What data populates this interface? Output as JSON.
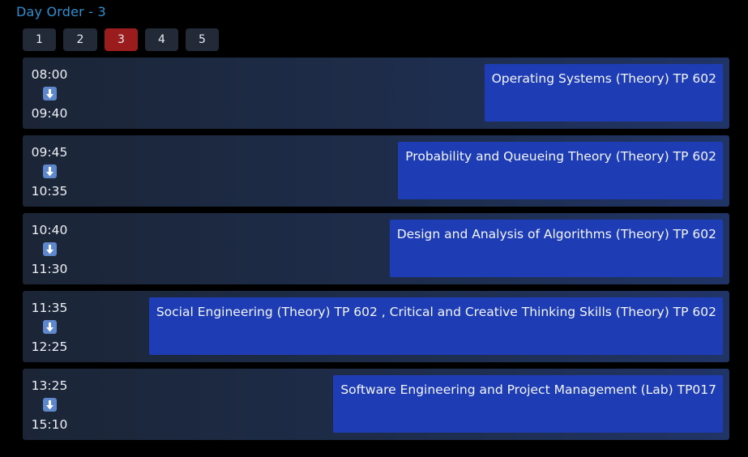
{
  "header": {
    "title": "Day Order - 3"
  },
  "day_tabs": [
    {
      "label": "1",
      "active": false
    },
    {
      "label": "2",
      "active": false
    },
    {
      "label": "3",
      "active": true
    },
    {
      "label": "4",
      "active": false
    },
    {
      "label": "5",
      "active": false
    }
  ],
  "schedule": [
    {
      "start": "08:00",
      "end": "09:40",
      "subject": "Operating Systems (Theory) TP 602"
    },
    {
      "start": "09:45",
      "end": "10:35",
      "subject": "Probability and Queueing Theory (Theory) TP 602"
    },
    {
      "start": "10:40",
      "end": "11:30",
      "subject": "Design and Analysis of Algorithms (Theory) TP 602"
    },
    {
      "start": "11:35",
      "end": "12:25",
      "subject": "Social Engineering (Theory) TP 602 , Critical and Creative Thinking Skills (Theory) TP 602"
    },
    {
      "start": "13:25",
      "end": "15:10",
      "subject": "Software Engineering and Project Management (Lab) TP017"
    }
  ],
  "icons": {
    "arrow": "down-arrow-icon"
  },
  "colors": {
    "title": "#2f8fd1",
    "tab_bg": "#222a37",
    "tab_active": "#9b1c1c",
    "subject_bg": "#1e3db5",
    "arrow_icon_bg": "#5f88cc"
  }
}
